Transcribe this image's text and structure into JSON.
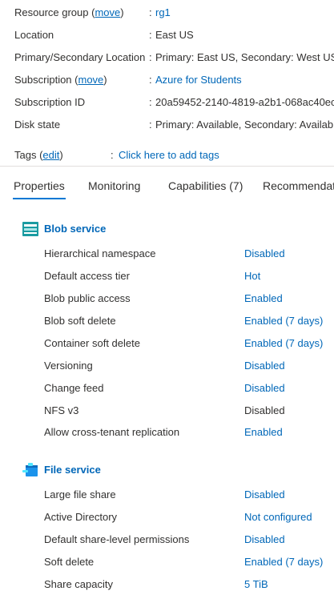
{
  "essentials": {
    "resource_group": {
      "label": "Resource group (",
      "link": "move",
      "label_end": ")",
      "value": "rg1"
    },
    "location": {
      "label": "Location",
      "value": "East US"
    },
    "primary_secondary_location": {
      "label": "Primary/Secondary Location",
      "value": "Primary: East US, Secondary: West US"
    },
    "subscription": {
      "label": "Subscription (",
      "link": "move",
      "label_end": ")",
      "value": "Azure for Students"
    },
    "subscription_id": {
      "label": "Subscription ID",
      "value": "20a59452-2140-4819-a2b1-068ac40ec"
    },
    "disk_state": {
      "label": "Disk state",
      "value": "Primary: Available, Secondary: Available"
    },
    "colon": ":"
  },
  "tags": {
    "label": "Tags (",
    "link": "edit",
    "label_end": ")",
    "value": "Click here to add tags"
  },
  "tabs": [
    {
      "label": "Properties",
      "active": true
    },
    {
      "label": "Monitoring",
      "active": false
    },
    {
      "label": "Capabilities (7)",
      "active": false
    },
    {
      "label": "Recommendations",
      "active": false
    }
  ],
  "blob_service": {
    "title": "Blob service",
    "icon": "blob-service-icon",
    "properties": [
      {
        "label": "Hierarchical namespace",
        "value": "Disabled",
        "link": true
      },
      {
        "label": "Default access tier",
        "value": "Hot",
        "link": true
      },
      {
        "label": "Blob public access",
        "value": "Enabled",
        "link": true
      },
      {
        "label": "Blob soft delete",
        "value": "Enabled (7 days)",
        "link": true
      },
      {
        "label": "Container soft delete",
        "value": "Enabled (7 days)",
        "link": true
      },
      {
        "label": "Versioning",
        "value": "Disabled",
        "link": true
      },
      {
        "label": "Change feed",
        "value": "Disabled",
        "link": true
      },
      {
        "label": "NFS v3",
        "value": "Disabled",
        "link": false
      },
      {
        "label": "Allow cross-tenant replication",
        "value": "Enabled",
        "link": true
      }
    ]
  },
  "file_service": {
    "title": "File service",
    "icon": "file-service-icon",
    "properties": [
      {
        "label": "Large file share",
        "value": "Disabled",
        "link": true
      },
      {
        "label": "Active Directory",
        "value": "Not configured",
        "link": true
      },
      {
        "label": "Default share-level permissions",
        "value": "Disabled",
        "link": true
      },
      {
        "label": "Soft delete",
        "value": "Enabled (7 days)",
        "link": true
      },
      {
        "label": "Share capacity",
        "value": "5 TiB",
        "link": true
      }
    ]
  },
  "colors": {
    "link": "#0067b8",
    "text": "#323130",
    "tab_underline": "#0078d4",
    "divider": "#e1dfdd",
    "blob_icon": "#1a9ba1",
    "file_icon": "#1b93eb"
  }
}
